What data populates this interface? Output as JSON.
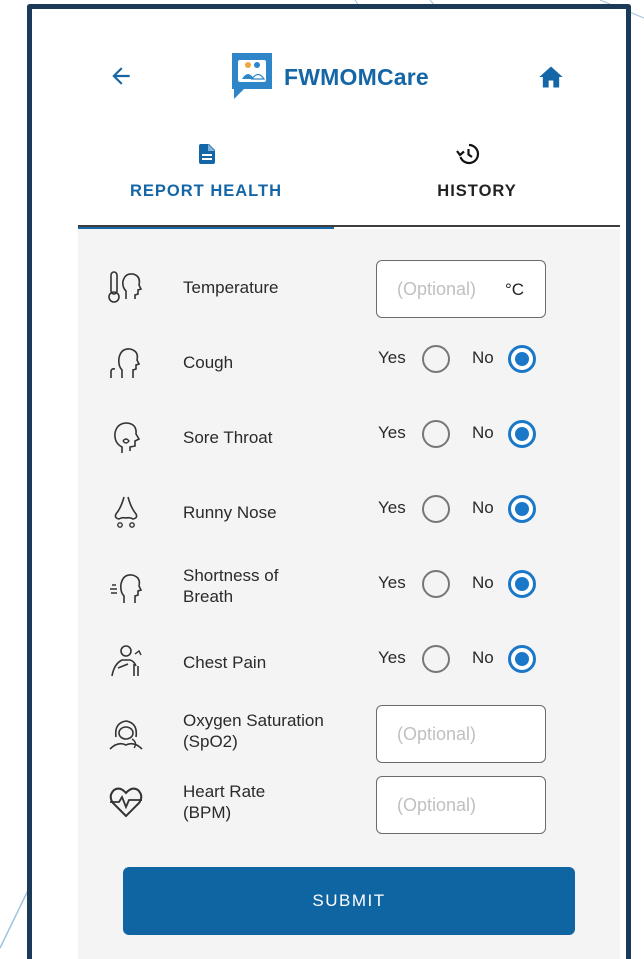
{
  "app": {
    "brand": "FWMOMCare"
  },
  "tabs": [
    {
      "label": "REPORT HEALTH",
      "active": true,
      "icon": "document-icon"
    },
    {
      "label": "HISTORY",
      "active": false,
      "icon": "history-icon"
    }
  ],
  "form": {
    "temperature": {
      "label": "Temperature",
      "placeholder": "(Optional)",
      "unit": "°C"
    },
    "symptoms": [
      {
        "label": "Cough",
        "yes": "Yes",
        "no": "No",
        "selected": "No"
      },
      {
        "label": "Sore Throat",
        "yes": "Yes",
        "no": "No",
        "selected": "No"
      },
      {
        "label": "Runny Nose",
        "yes": "Yes",
        "no": "No",
        "selected": "No"
      },
      {
        "label_line1": "Shortness of",
        "label_line2": "Breath",
        "yes": "Yes",
        "no": "No",
        "selected": "No"
      },
      {
        "label": "Chest Pain",
        "yes": "Yes",
        "no": "No",
        "selected": "No"
      }
    ],
    "oxygen": {
      "label_line1": "Oxygen Saturation",
      "label_line2": "(SpO2)",
      "placeholder": "(Optional)"
    },
    "heart_rate": {
      "label_line1": "Heart Rate",
      "label_line2": "(BPM)",
      "placeholder": "(Optional)"
    },
    "submit_label": "SUBMIT"
  },
  "colors": {
    "accent": "#1566a6",
    "radio_selected": "#1b78c9",
    "button": "#0f64a2",
    "frame": "#1b3a57"
  }
}
